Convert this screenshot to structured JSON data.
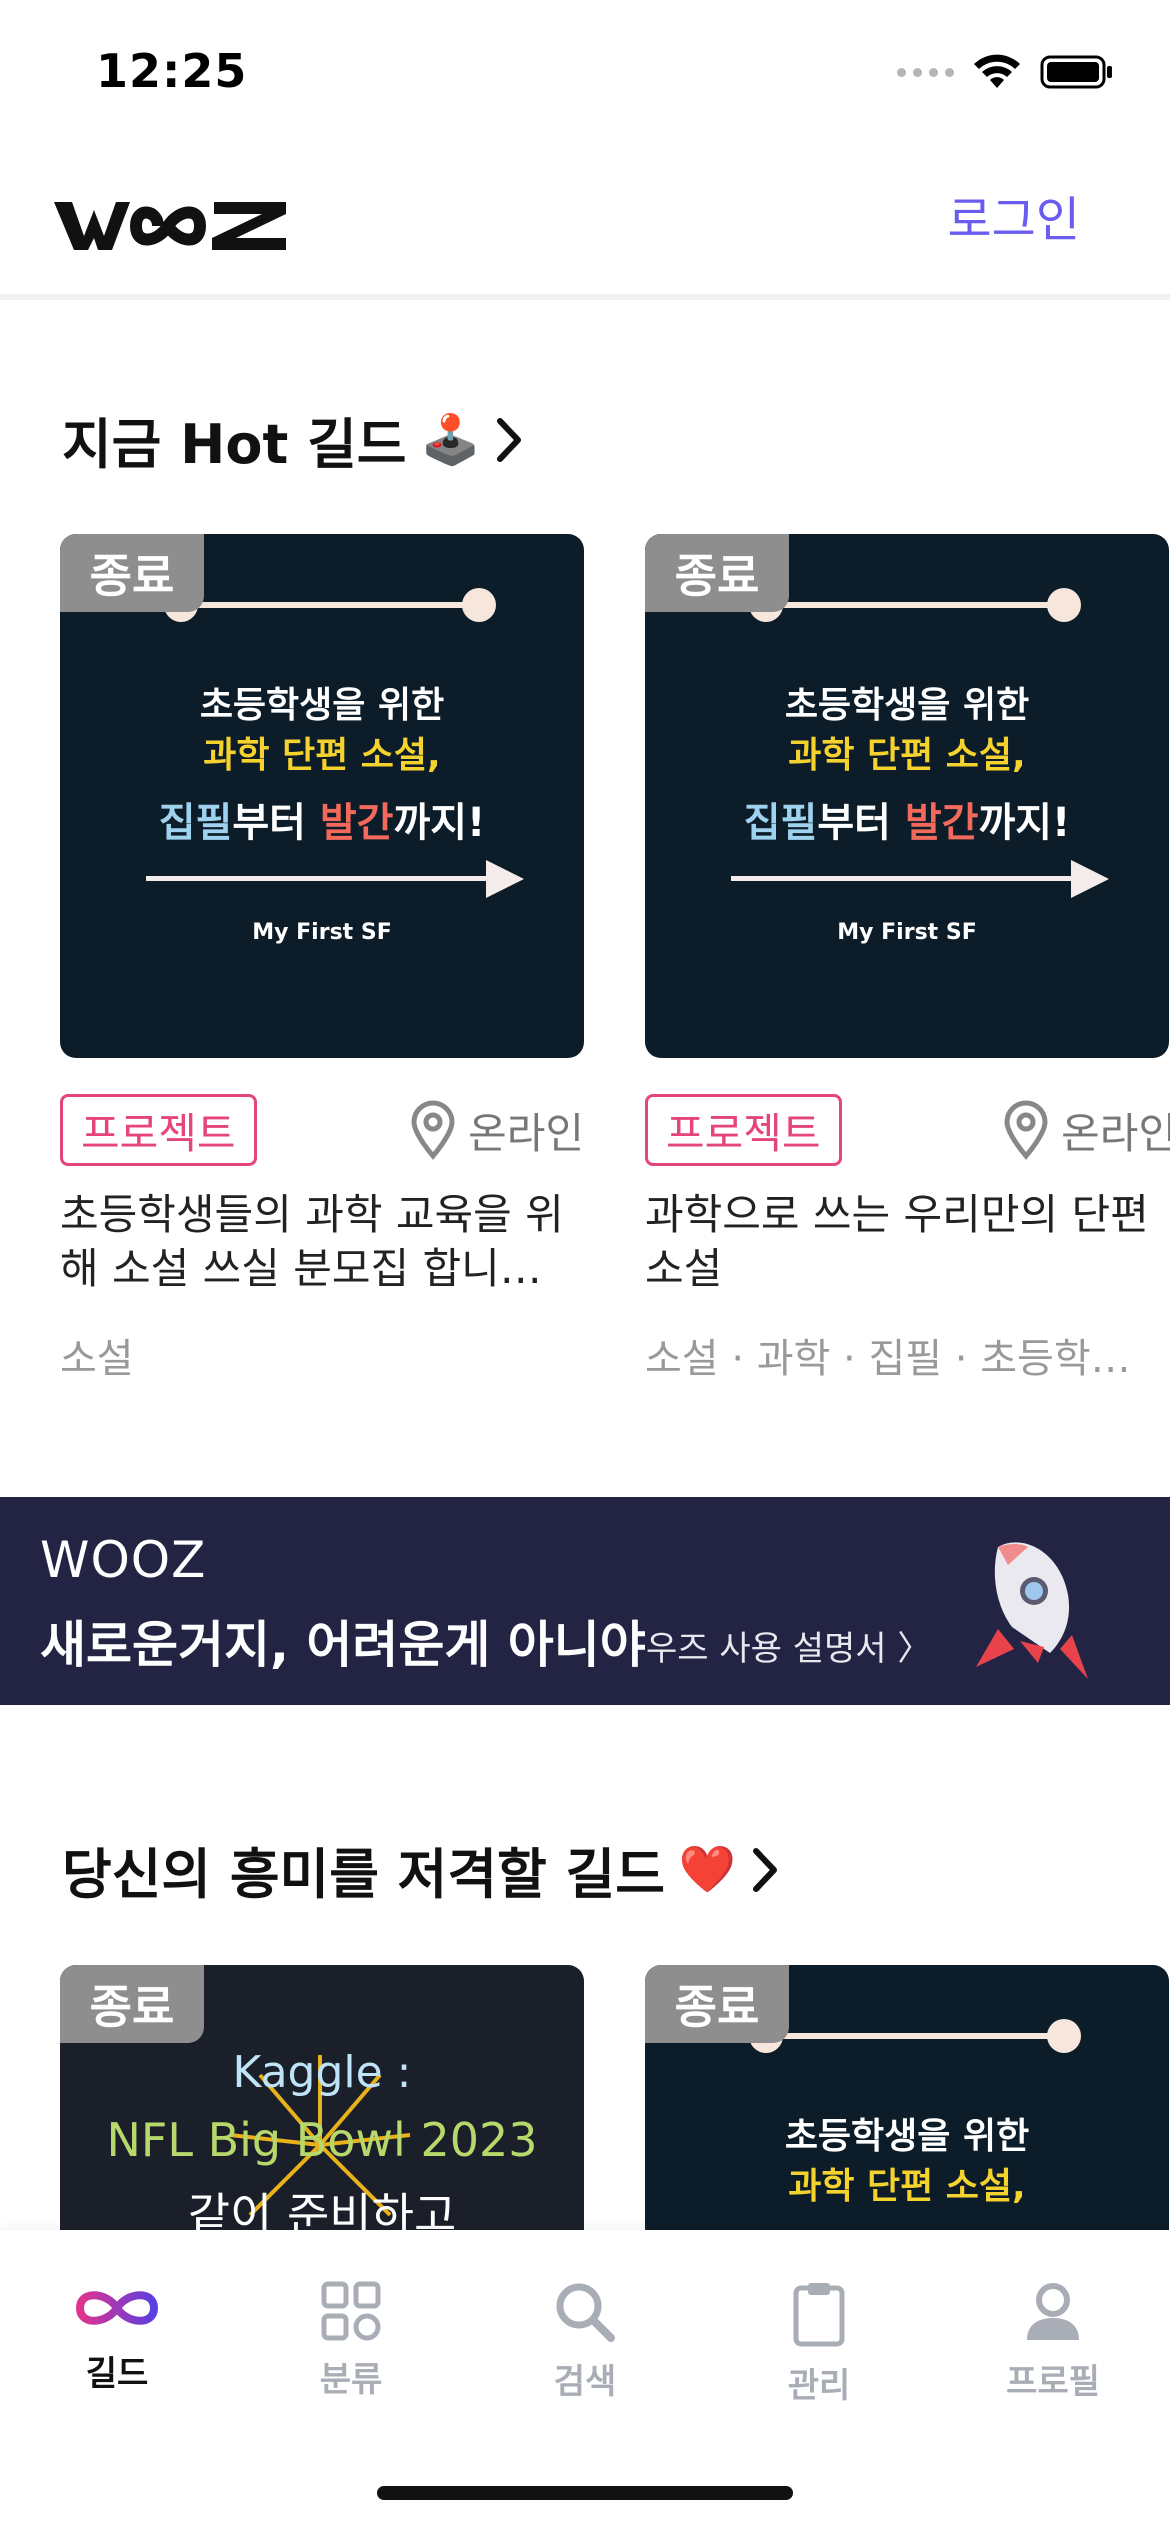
{
  "status_bar": {
    "time": "12:25"
  },
  "header": {
    "logo_text": "WOOZ",
    "login_label": "로그인"
  },
  "hot_section": {
    "title": "지금 Hot 길드",
    "emoji": "🕹️",
    "chevron": "›",
    "cards": [
      {
        "badge": "종료",
        "thumb_lines": [
          "초등학생을 위한",
          "과학 단편 소설,",
          "집필",
          "부터 ",
          "발간",
          "까지!",
          "My First SF"
        ],
        "tag": "프로젝트",
        "location": "온라인",
        "description": "초등학생들의 과학 교육을 위해 소설 쓰실 분모집 합니…",
        "categories": "소설"
      },
      {
        "badge": "종료",
        "thumb_lines": [
          "초등학생을 위한",
          "과학 단편 소설,",
          "집필",
          "부터 ",
          "발간",
          "까지!",
          "My First SF"
        ],
        "tag": "프로젝트",
        "location": "온라인",
        "description": "과학으로 쓰는 우리만의 단편소설",
        "categories": "소설 · 과학 · 집필 · 초등학…"
      }
    ]
  },
  "banner": {
    "brand": "WOOZ",
    "headline": "새로운거지, 어려운게 아니야",
    "link_label": "우즈 사용 설명서 〉"
  },
  "interest_section": {
    "title": "당신의 흥미를 저격할 길드",
    "emoji": "❤️",
    "chevron": "›",
    "cards": [
      {
        "badge": "종료",
        "thumb_lines": [
          "Kaggle :",
          "NFL Big Bowl 2023",
          "같이 준비하고"
        ]
      },
      {
        "badge": "종료",
        "thumb_lines": [
          "초등학생을 위한",
          "과학 단편 소설,"
        ]
      }
    ]
  },
  "tab_bar": {
    "tabs": [
      {
        "label": "길드",
        "icon": "infinity-icon",
        "active": true
      },
      {
        "label": "분류",
        "icon": "grid-icon",
        "active": false
      },
      {
        "label": "검색",
        "icon": "search-icon",
        "active": false
      },
      {
        "label": "관리",
        "icon": "clipboard-icon",
        "active": false
      },
      {
        "label": "프로필",
        "icon": "person-icon",
        "active": false
      }
    ]
  },
  "colors": {
    "accent": "#6b5cf0",
    "tag_pink": "#e6447e",
    "thumb_bg": "#0c1d29",
    "banner_bg": "#232344",
    "thumb_yellow": "#f5d22e",
    "thumb_blue": "#9fd2ee",
    "thumb_red": "#f36a5c"
  }
}
